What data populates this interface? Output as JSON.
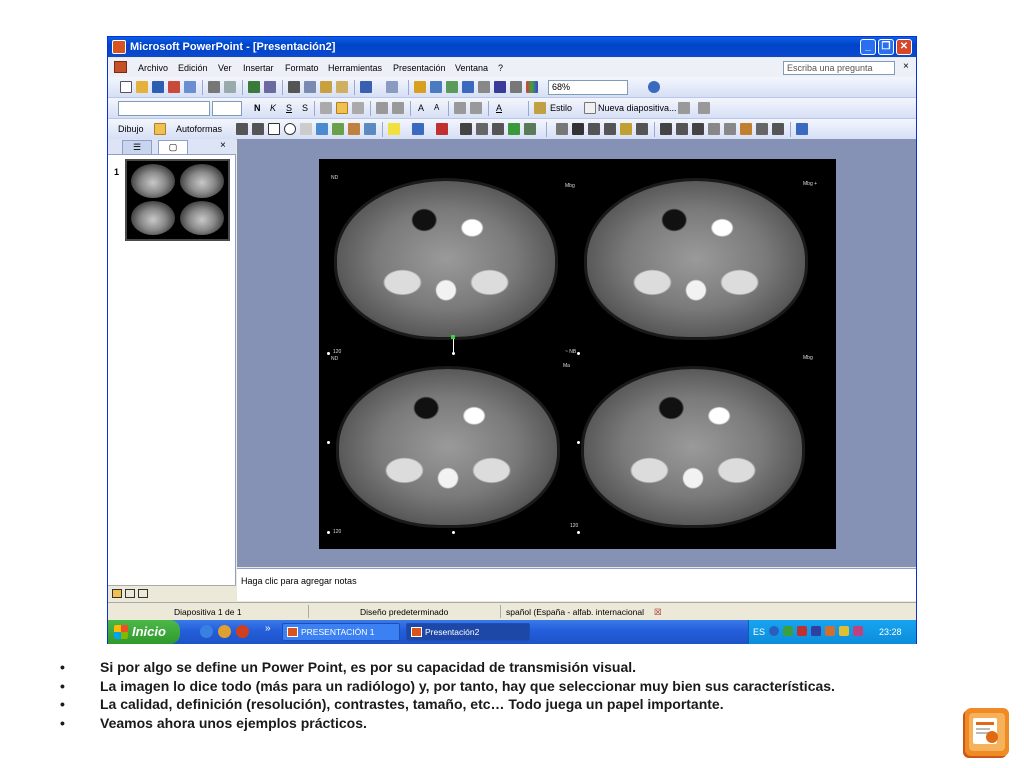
{
  "window": {
    "title": "Microsoft PowerPoint - [Presentación2]"
  },
  "menubar": {
    "items": [
      "Archivo",
      "Edición",
      "Ver",
      "Insertar",
      "Formato",
      "Herramientas",
      "Presentación",
      "Ventana",
      "?"
    ],
    "ask_placeholder": "Escriba una pregunta",
    "close_glyph": "×"
  },
  "toolbar_standard": {
    "zoom": "68%"
  },
  "toolbar_format": {
    "bold": "N",
    "italic": "K",
    "underline": "S",
    "shadow": "S",
    "grow_font": "A",
    "shrink_font": "A",
    "font_color": "A",
    "style_label": "Estilo",
    "new_slide_label": "Nueva diapositiva..."
  },
  "toolbar_drawing": {
    "draw_label": "Dibujo",
    "autoshapes_label": "Autoformas"
  },
  "left_pane": {
    "close_glyph": "×",
    "slide_number": "1"
  },
  "slide": {
    "labels": {
      "top_left": "ND",
      "top_center": "Mbg",
      "top_right": "Mbg +",
      "mid_left_num": "120",
      "mid_left": "ND",
      "mid_center_num": "~ NB",
      "mid_center": "Ma",
      "mid_right": "Mbg",
      "bottom_left": "120",
      "bottom_center": "120"
    }
  },
  "notes": {
    "placeholder": "Haga clic para agregar notas"
  },
  "statusbar": {
    "slide_info": "Diapositiva 1 de 1",
    "design": "Diseño predeterminado",
    "language": "spañol (España - alfab. internacional"
  },
  "taskbar": {
    "start_label": "Inicio",
    "chevron": "»",
    "tasks": [
      "PRESENTACIÓN 1",
      "Presentación2"
    ],
    "language": "ES",
    "clock": "23:28"
  },
  "bullets": {
    "mark": "•",
    "items": [
      "Si por algo se define un Power Point, es por su capacidad de transmisión visual.",
      "La imagen lo dice todo (más para un radiólogo) y, por tanto, hay que seleccionar muy bien sus características.",
      "La calidad, definición (resolución), contrastes, tamaño, etc… Todo juega un papel importante.",
      "Veamos ahora unos ejemplos prácticos."
    ]
  },
  "colors": {
    "titlebar": "#0a5fe8",
    "taskbar": "#245edb",
    "start": "#2f9a2c",
    "slide_bg": "#000000",
    "workspace": "#8592b5",
    "ppt_logo": "#e87b1e"
  }
}
